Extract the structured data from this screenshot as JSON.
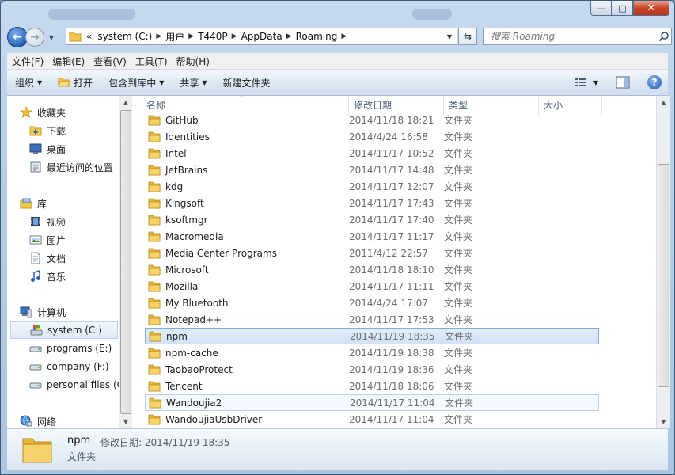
{
  "window": {
    "minimize_glyph": "—",
    "maximize_glyph": "□",
    "close_glyph": "✕"
  },
  "nav": {
    "back_glyph": "←",
    "forward_glyph": "→",
    "history_glyph": "▼",
    "overflow_glyph": "«",
    "breadcrumbs": [
      "system (C:)",
      "用户",
      "T440P",
      "AppData",
      "Roaming"
    ],
    "refresh_glyph": "⇆",
    "search_placeholder": "搜索 Roaming"
  },
  "menu": [
    "文件(F)",
    "编辑(E)",
    "查看(V)",
    "工具(T)",
    "帮助(H)"
  ],
  "toolbar": {
    "organize": "组织",
    "open": "打开",
    "include_library": "包含到库中",
    "share": "共享",
    "new_folder": "新建文件夹",
    "help_glyph": "?"
  },
  "sidebar": {
    "favorites": {
      "label": "收藏夹",
      "items": [
        "下载",
        "桌面",
        "最近访问的位置"
      ]
    },
    "libraries": {
      "label": "库",
      "items": [
        "视频",
        "图片",
        "文档",
        "音乐"
      ]
    },
    "computer": {
      "label": "计算机",
      "items": [
        "system (C:)",
        "programs (E:)",
        "company (F:)",
        "personal files (G:)"
      ]
    },
    "network": {
      "label": "网络"
    }
  },
  "columns": {
    "name": "名称",
    "modified": "修改日期",
    "type": "类型",
    "size": "大小"
  },
  "files": [
    {
      "name": "GitHub",
      "modified": "2014/11/18 18:21",
      "type": "文件夹"
    },
    {
      "name": "Identities",
      "modified": "2014/4/24 16:58",
      "type": "文件夹"
    },
    {
      "name": "Intel",
      "modified": "2014/11/17 10:52",
      "type": "文件夹"
    },
    {
      "name": "JetBrains",
      "modified": "2014/11/17 14:48",
      "type": "文件夹"
    },
    {
      "name": "kdg",
      "modified": "2014/11/17 12:07",
      "type": "文件夹"
    },
    {
      "name": "Kingsoft",
      "modified": "2014/11/17 17:43",
      "type": "文件夹"
    },
    {
      "name": "ksoftmgr",
      "modified": "2014/11/17 17:40",
      "type": "文件夹"
    },
    {
      "name": "Macromedia",
      "modified": "2014/11/17 11:17",
      "type": "文件夹"
    },
    {
      "name": "Media Center Programs",
      "modified": "2011/4/12 22:57",
      "type": "文件夹"
    },
    {
      "name": "Microsoft",
      "modified": "2014/11/18 18:10",
      "type": "文件夹"
    },
    {
      "name": "Mozilla",
      "modified": "2014/11/17 11:11",
      "type": "文件夹"
    },
    {
      "name": "My Bluetooth",
      "modified": "2014/4/24 17:07",
      "type": "文件夹"
    },
    {
      "name": "Notepad++",
      "modified": "2014/11/17 17:53",
      "type": "文件夹"
    },
    {
      "name": "npm",
      "modified": "2014/11/19 18:35",
      "type": "文件夹"
    },
    {
      "name": "npm-cache",
      "modified": "2014/11/19 18:38",
      "type": "文件夹"
    },
    {
      "name": "TaobaoProtect",
      "modified": "2014/11/19 18:36",
      "type": "文件夹"
    },
    {
      "name": "Tencent",
      "modified": "2014/11/18 18:06",
      "type": "文件夹"
    },
    {
      "name": "Wandoujia2",
      "modified": "2014/11/17 11:04",
      "type": "文件夹"
    },
    {
      "name": "WandoujiaUsbDriver",
      "modified": "2014/11/17 11:04",
      "type": "文件夹"
    }
  ],
  "selected_index": 13,
  "hover_index": 17,
  "details": {
    "name": "npm",
    "modified_label": "修改日期:",
    "modified_value": "2014/11/19 18:35",
    "type": "文件夹"
  },
  "colors": {
    "folder": "#f2c84b",
    "folder_dark": "#d9a52a",
    "selection": "#cfe2f7",
    "accent": "#2a63b8"
  }
}
